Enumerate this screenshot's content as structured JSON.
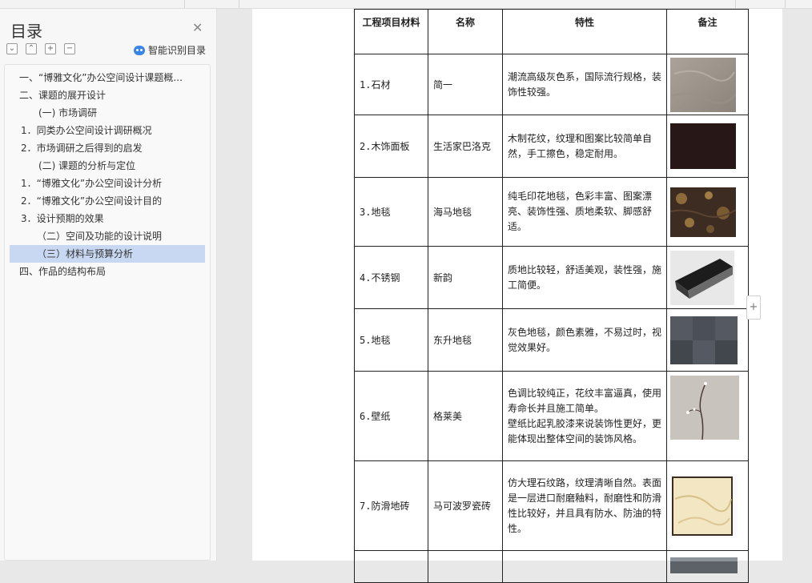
{
  "nav": {
    "title": "目录",
    "smart_label": "智能识别目录",
    "toolbar": {
      "collapse": "⌄",
      "expand": "⌃",
      "add": "+",
      "remove": "−"
    },
    "items": [
      {
        "label": "一、“博雅文化”办公空间设计课题概..."
      },
      {
        "label": "二、课题的展开设计"
      },
      {
        "label": "(一) 市场调研"
      },
      {
        "label": "1．同类办公空间设计调研概况"
      },
      {
        "label": "2．市场调研之后得到的启发"
      },
      {
        "label": "(二) 课题的分析与定位"
      },
      {
        "label": "1．“博雅文化”办公空间设计分析"
      },
      {
        "label": "2．“博雅文化”办公空间设计目的"
      },
      {
        "label": "3．设计预期的效果"
      },
      {
        "label": "（二）空间及功能的设计说明"
      },
      {
        "label": "（三）材料与预算分析"
      },
      {
        "label": "四、作品的结构布局"
      }
    ]
  },
  "table": {
    "headers": [
      "工程项目材料",
      "名称",
      "特性",
      "备注"
    ],
    "rows": [
      {
        "material": "1.石材",
        "name": "简一",
        "feature": "潮流高级灰色系，国际流行规格，装饰性较强。",
        "image": "stone-gray"
      },
      {
        "material": "2.木饰面板",
        "name": "生活家巴洛克",
        "feature": "木制花纹，纹理和图案比较简单自然，手工擦色，稳定耐用。",
        "image": "dark-wood"
      },
      {
        "material": "3.地毯",
        "name": "海马地毯",
        "feature": "纯毛印花地毯，色彩丰富、图案漂亮、装饰性强、质地柔软、脚感舒适。",
        "image": "floral-carpet"
      },
      {
        "material": "4.不锈钢",
        "name": "新韵",
        "feature": "质地比较轻，舒适美观，装性强，施工简便。",
        "image": "steel-profile"
      },
      {
        "material": "5.地毯",
        "name": "东升地毯",
        "feature": "灰色地毯，颜色素雅，不易过时，视觉效果好。",
        "image": "gray-carpet"
      },
      {
        "material": "6.壁纸",
        "name": "格莱美",
        "feature": "色调比较纯正，花纹丰富逼真，使用寿命长并且施工简单。\n壁纸比起乳胶漆来说装饰性更好，更能体现出整体空间的装饰风格。",
        "image": "floral-wallpaper"
      },
      {
        "material": "7.防滑地砖",
        "name": "马可波罗瓷砖",
        "feature": "仿大理石纹路，纹理清晰自然。表面是一层进口耐磨釉料，耐磨性和防滑性比较好，并且具有防水、防油的特性。",
        "image": "marble-tile"
      },
      {
        "material": "",
        "name": "",
        "feature": "",
        "image": "partial"
      }
    ]
  },
  "side_button": "+"
}
